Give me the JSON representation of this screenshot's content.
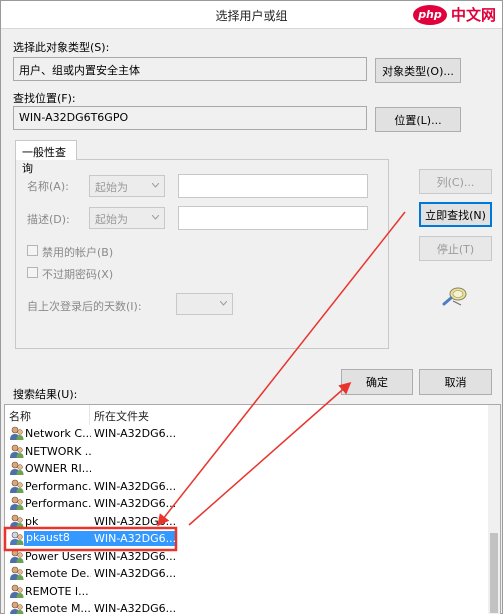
{
  "window": {
    "title": "选择用户或组"
  },
  "watermark": {
    "logo": "php",
    "text": "中文网"
  },
  "object_type": {
    "label": "选择此对象类型(S):",
    "value": "用户、组或内置安全主体",
    "button": "对象类型(O)..."
  },
  "location": {
    "label": "查找位置(F):",
    "value": "WIN-A32DG6T6GPO",
    "button": "位置(L)..."
  },
  "query": {
    "tab": "一般性查询",
    "name_label": "名称(A):",
    "name_mode": "起始为",
    "desc_label": "描述(D):",
    "desc_mode": "起始为",
    "disabled_accounts": "禁用的帐户(B)",
    "non_expiring": "不过期密码(X)",
    "days_label": "自上次登录后的天数(I):"
  },
  "side_buttons": {
    "columns": "列(C)...",
    "find_now": "立即查找(N)",
    "stop": "停止(T)"
  },
  "dialog_buttons": {
    "ok": "确定",
    "cancel": "取消"
  },
  "results": {
    "label": "搜索结果(U):",
    "columns": [
      "名称",
      "所在文件夹"
    ],
    "rows": [
      {
        "name": "Network C...",
        "folder": "WIN-A32DG6..."
      },
      {
        "name": "NETWORK ...",
        "folder": ""
      },
      {
        "name": "OWNER RI...",
        "folder": ""
      },
      {
        "name": "Performanc...",
        "folder": "WIN-A32DG6..."
      },
      {
        "name": "Performanc...",
        "folder": "WIN-A32DG6..."
      },
      {
        "name": "pk",
        "folder": "WIN-A32DG6..."
      },
      {
        "name": "pkaust8",
        "folder": "WIN-A32DG6..."
      },
      {
        "name": "Power Users",
        "folder": "WIN-A32DG6..."
      },
      {
        "name": "Remote De...",
        "folder": "WIN-A32DG6..."
      },
      {
        "name": "REMOTE I...",
        "folder": ""
      },
      {
        "name": "Remote M...",
        "folder": "WIN-A32DG6..."
      }
    ],
    "selected_index": 6
  },
  "colors": {
    "selection": "#3399ff",
    "annotation": "#e8342c",
    "accent": "#0078d7"
  }
}
